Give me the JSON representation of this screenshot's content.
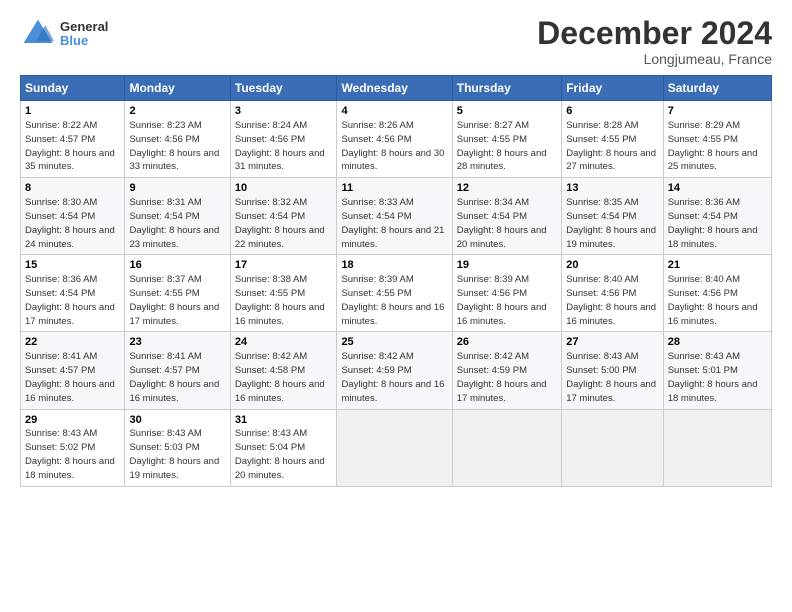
{
  "header": {
    "logo_line1": "General",
    "logo_line2": "Blue",
    "title": "December 2024",
    "subtitle": "Longjumeau, France"
  },
  "days_of_week": [
    "Sunday",
    "Monday",
    "Tuesday",
    "Wednesday",
    "Thursday",
    "Friday",
    "Saturday"
  ],
  "weeks": [
    [
      {
        "day": 1,
        "sunrise": "8:22 AM",
        "sunset": "4:57 PM",
        "daylight": "8 hours and 35 minutes."
      },
      {
        "day": 2,
        "sunrise": "8:23 AM",
        "sunset": "4:56 PM",
        "daylight": "8 hours and 33 minutes."
      },
      {
        "day": 3,
        "sunrise": "8:24 AM",
        "sunset": "4:56 PM",
        "daylight": "8 hours and 31 minutes."
      },
      {
        "day": 4,
        "sunrise": "8:26 AM",
        "sunset": "4:56 PM",
        "daylight": "8 hours and 30 minutes."
      },
      {
        "day": 5,
        "sunrise": "8:27 AM",
        "sunset": "4:55 PM",
        "daylight": "8 hours and 28 minutes."
      },
      {
        "day": 6,
        "sunrise": "8:28 AM",
        "sunset": "4:55 PM",
        "daylight": "8 hours and 27 minutes."
      },
      {
        "day": 7,
        "sunrise": "8:29 AM",
        "sunset": "4:55 PM",
        "daylight": "8 hours and 25 minutes."
      }
    ],
    [
      {
        "day": 8,
        "sunrise": "8:30 AM",
        "sunset": "4:54 PM",
        "daylight": "8 hours and 24 minutes."
      },
      {
        "day": 9,
        "sunrise": "8:31 AM",
        "sunset": "4:54 PM",
        "daylight": "8 hours and 23 minutes."
      },
      {
        "day": 10,
        "sunrise": "8:32 AM",
        "sunset": "4:54 PM",
        "daylight": "8 hours and 22 minutes."
      },
      {
        "day": 11,
        "sunrise": "8:33 AM",
        "sunset": "4:54 PM",
        "daylight": "8 hours and 21 minutes."
      },
      {
        "day": 12,
        "sunrise": "8:34 AM",
        "sunset": "4:54 PM",
        "daylight": "8 hours and 20 minutes."
      },
      {
        "day": 13,
        "sunrise": "8:35 AM",
        "sunset": "4:54 PM",
        "daylight": "8 hours and 19 minutes."
      },
      {
        "day": 14,
        "sunrise": "8:36 AM",
        "sunset": "4:54 PM",
        "daylight": "8 hours and 18 minutes."
      }
    ],
    [
      {
        "day": 15,
        "sunrise": "8:36 AM",
        "sunset": "4:54 PM",
        "daylight": "8 hours and 17 minutes."
      },
      {
        "day": 16,
        "sunrise": "8:37 AM",
        "sunset": "4:55 PM",
        "daylight": "8 hours and 17 minutes."
      },
      {
        "day": 17,
        "sunrise": "8:38 AM",
        "sunset": "4:55 PM",
        "daylight": "8 hours and 16 minutes."
      },
      {
        "day": 18,
        "sunrise": "8:39 AM",
        "sunset": "4:55 PM",
        "daylight": "8 hours and 16 minutes."
      },
      {
        "day": 19,
        "sunrise": "8:39 AM",
        "sunset": "4:56 PM",
        "daylight": "8 hours and 16 minutes."
      },
      {
        "day": 20,
        "sunrise": "8:40 AM",
        "sunset": "4:56 PM",
        "daylight": "8 hours and 16 minutes."
      },
      {
        "day": 21,
        "sunrise": "8:40 AM",
        "sunset": "4:56 PM",
        "daylight": "8 hours and 16 minutes."
      }
    ],
    [
      {
        "day": 22,
        "sunrise": "8:41 AM",
        "sunset": "4:57 PM",
        "daylight": "8 hours and 16 minutes."
      },
      {
        "day": 23,
        "sunrise": "8:41 AM",
        "sunset": "4:57 PM",
        "daylight": "8 hours and 16 minutes."
      },
      {
        "day": 24,
        "sunrise": "8:42 AM",
        "sunset": "4:58 PM",
        "daylight": "8 hours and 16 minutes."
      },
      {
        "day": 25,
        "sunrise": "8:42 AM",
        "sunset": "4:59 PM",
        "daylight": "8 hours and 16 minutes."
      },
      {
        "day": 26,
        "sunrise": "8:42 AM",
        "sunset": "4:59 PM",
        "daylight": "8 hours and 17 minutes."
      },
      {
        "day": 27,
        "sunrise": "8:43 AM",
        "sunset": "5:00 PM",
        "daylight": "8 hours and 17 minutes."
      },
      {
        "day": 28,
        "sunrise": "8:43 AM",
        "sunset": "5:01 PM",
        "daylight": "8 hours and 18 minutes."
      }
    ],
    [
      {
        "day": 29,
        "sunrise": "8:43 AM",
        "sunset": "5:02 PM",
        "daylight": "8 hours and 18 minutes."
      },
      {
        "day": 30,
        "sunrise": "8:43 AM",
        "sunset": "5:03 PM",
        "daylight": "8 hours and 19 minutes."
      },
      {
        "day": 31,
        "sunrise": "8:43 AM",
        "sunset": "5:04 PM",
        "daylight": "8 hours and 20 minutes."
      },
      null,
      null,
      null,
      null
    ]
  ]
}
